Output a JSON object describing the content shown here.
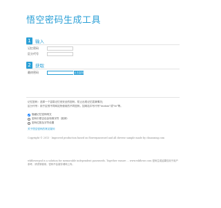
{
  "page": {
    "title": "悟空密码生成工具"
  },
  "step1": {
    "number": "1",
    "label": "输入",
    "fields": [
      {
        "label": "记忆密码",
        "value": "",
        "placeholder": ""
      },
      {
        "label": "区分代号",
        "value": "",
        "placeholder": ""
      }
    ]
  },
  "step2": {
    "number": "2",
    "label": "获取",
    "field": {
      "label": "最终密码",
      "value": "",
      "placeholder": ""
    },
    "button_label": "点击复制"
  },
  "notes": [
    "记忆密码：选择一个容易记忆但安全的密码，防止出现记忆混淆情况；",
    "区分代号：用于区别不同网站所使用的不同密码，如网站中写代号\"taobao\"或\"tb\"等。"
  ],
  "options": [
    {
      "label": "隐藏记忆密码明文",
      "checked": true
    },
    {
      "label": "密码中是否包含特殊字符（推荐）",
      "checked": false
    },
    {
      "label": "密码位数及字符设置",
      "checked": false
    }
  ],
  "link_label": "关于悟空密码的常见疑问",
  "footer": {
    "line1": "Copyright © 2013 · Improved production based on flowerpassword and all diverse sample made by chuanxing.com",
    "line2": "wkflowerpsd is a solution for memorable independent passwords. Together ensure ... www.wkflowe.com 密码生成结果仅用于用户参考，请谨慎使用，密码不会被存储和上传。"
  }
}
